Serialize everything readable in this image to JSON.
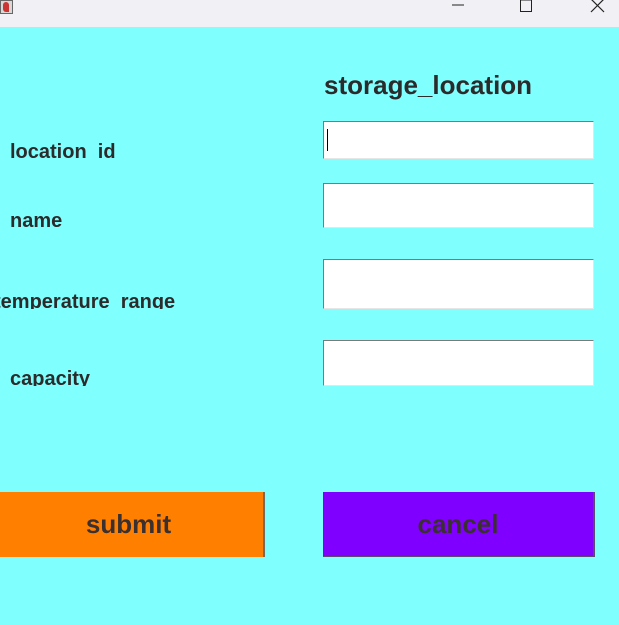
{
  "window": {
    "controls": {
      "minimize": "minimize-icon",
      "maximize": "maximize-icon",
      "close": "close-icon"
    }
  },
  "form": {
    "title": "storage_location",
    "fields": [
      {
        "label": "location  id",
        "value": ""
      },
      {
        "label": "name",
        "value": ""
      },
      {
        "label": "temperature  range",
        "value": ""
      },
      {
        "label": "capacity",
        "value": ""
      }
    ],
    "submit_label": "submit",
    "cancel_label": "cancel"
  },
  "colors": {
    "background": "#80ffff",
    "submit": "#ff8000",
    "cancel": "#8000ff",
    "text": "#2b2b2b"
  }
}
